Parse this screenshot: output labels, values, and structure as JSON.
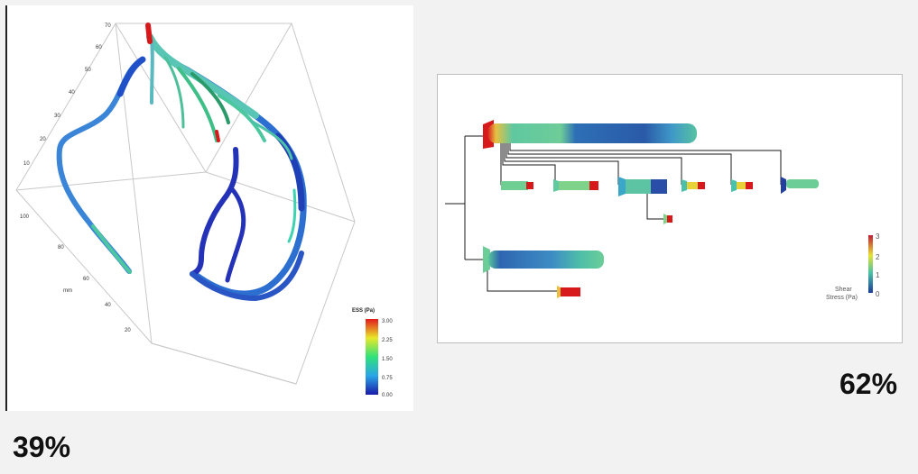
{
  "left_panel": {
    "colorbar_title": "ESS (Pa)",
    "colorbar_ticks": [
      "3.00",
      "2.25",
      "1.50",
      "0.75",
      "0.00"
    ],
    "axis_unit": "mm",
    "z_ticks": [
      "70",
      "60",
      "50",
      "40",
      "30",
      "20",
      "10"
    ],
    "depth_ticks": [
      "100",
      "80",
      "60",
      "40",
      "20"
    ],
    "percentage": "39%"
  },
  "right_panel": {
    "colorbar_title_line1": "Shear",
    "colorbar_title_line2": "Stress (Pa)",
    "colorbar_ticks": [
      "3",
      "2",
      "1",
      "0"
    ],
    "percentage": "62%"
  },
  "colors": {
    "high": "#d7191c",
    "mid_high": "#f0e442",
    "mid": "#4dc78a",
    "mid_low": "#3a9fd5",
    "low": "#2330a8"
  }
}
